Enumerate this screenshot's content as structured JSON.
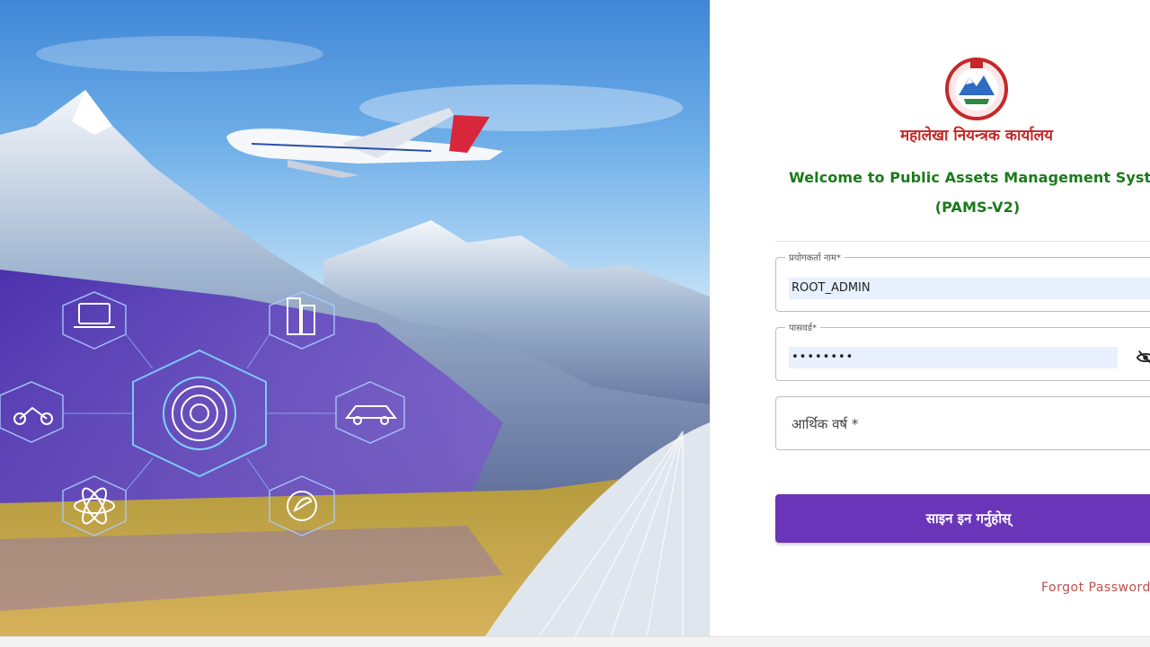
{
  "hero": {
    "icons": [
      "laptop-icon",
      "building-icon",
      "fingerprint-icon",
      "motorcycle-icon",
      "car-icon",
      "atom-icon",
      "eco-gear-icon"
    ]
  },
  "header": {
    "office_name": "महालेखा नियन्त्रक कार्यालय",
    "welcome_line1": "Welcome to Public Assets Management System",
    "welcome_line2": "(PAMS-V2)"
  },
  "login": {
    "username_label": "प्रयोगकर्ता नाम*",
    "username_value": "ROOT_ADMIN",
    "password_label": "पासवर्ड*",
    "password_value": "••••••••",
    "fiscal_year_placeholder": "आर्थिक वर्ष *",
    "submit_label": "साइन इन गर्नुहोस्",
    "forgot_label": "Forgot Password"
  },
  "colors": {
    "primary_button": "#6a35b8",
    "office_name": "#c62828",
    "welcome_text": "#1b7a1b",
    "autofill_bg": "#e8f0fe",
    "forgot_link": "#c0504d"
  }
}
